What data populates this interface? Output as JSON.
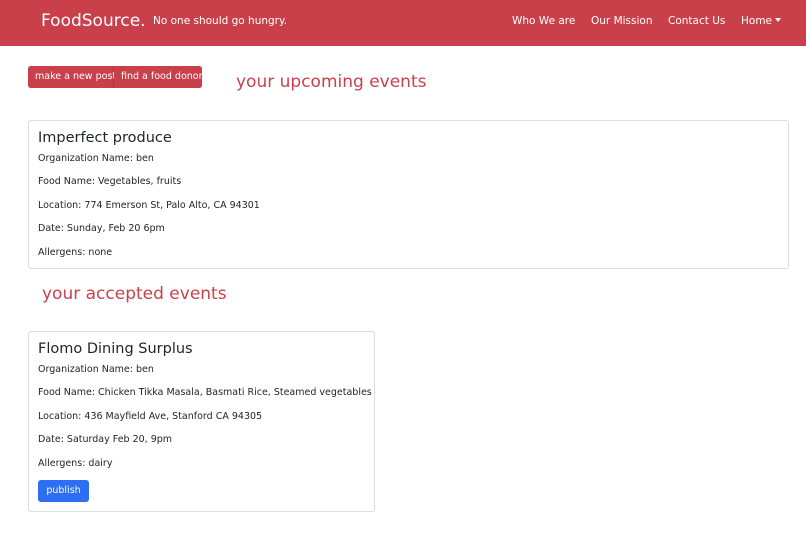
{
  "navbar": {
    "brand": "FoodSource.",
    "tagline": "No one should go hungry.",
    "links": [
      "Who We are",
      "Our Mission",
      "Contact Us"
    ],
    "home_label": "Home"
  },
  "actions": {
    "new_post_label": "make a new post",
    "find_donor_label": "find a food donor"
  },
  "upcoming": {
    "heading": "your upcoming events",
    "event": {
      "title": "Imperfect produce",
      "organization": "Organization Name: ben",
      "food": "Food Name: Vegetables, fruits",
      "location": "Location: 774 Emerson St, Palo Alto, CA 94301",
      "date": "Date: Sunday, Feb 20 6pm",
      "allergens": "Allergens: none"
    }
  },
  "accepted": {
    "heading": "your accepted events",
    "event": {
      "title": "Flomo Dining Surplus",
      "organization": "Organization Name: ben",
      "food": "Food Name: Chicken Tikka Masala, Basmati Rice, Steamed vegetables",
      "location": "Location: 436 Mayfield Ave, Stanford CA 94305",
      "date": "Date: Saturday Feb 20, 9pm",
      "allergens": "Allergens: dairy",
      "publish_label": "publish"
    }
  },
  "colors": {
    "brand_red": "#c9404a",
    "button_blue": "#2d6ef5"
  }
}
